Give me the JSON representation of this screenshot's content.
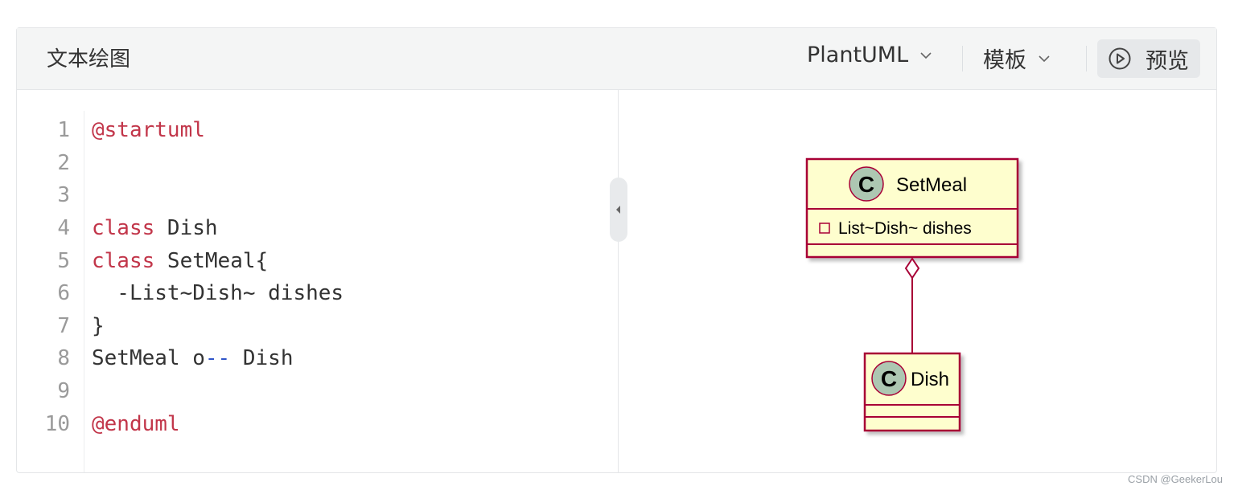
{
  "header": {
    "title": "文本绘图",
    "language_dropdown": "PlantUML",
    "template_dropdown": "模板",
    "preview_button": "预览"
  },
  "editor": {
    "line_numbers": [
      "1",
      "2",
      "3",
      "4",
      "5",
      "6",
      "7",
      "8",
      "9",
      "10"
    ],
    "lines": [
      [
        {
          "t": "@startuml",
          "k": "kw"
        }
      ],
      [],
      [],
      [
        {
          "t": "class",
          "k": "kw"
        },
        {
          "t": " Dish",
          "k": ""
        }
      ],
      [
        {
          "t": "class",
          "k": "kw"
        },
        {
          "t": " SetMeal{",
          "k": ""
        }
      ],
      [
        {
          "t": "  -List~Dish~ dishes",
          "k": ""
        }
      ],
      [
        {
          "t": "}",
          "k": ""
        }
      ],
      [
        {
          "t": "SetMeal o",
          "k": ""
        },
        {
          "t": "--",
          "k": "op"
        },
        {
          "t": " Dish",
          "k": ""
        }
      ],
      [],
      [
        {
          "t": "@enduml",
          "k": "kw"
        }
      ]
    ]
  },
  "diagram": {
    "class_setmeal": {
      "icon": "C",
      "name": "SetMeal",
      "field": "List~Dish~ dishes"
    },
    "class_dish": {
      "icon": "C",
      "name": "Dish"
    },
    "colors": {
      "fill": "#fefece",
      "border": "#a80036",
      "icon_fill": "#adc7b2"
    }
  },
  "watermark": "CSDN @GeekerLou"
}
